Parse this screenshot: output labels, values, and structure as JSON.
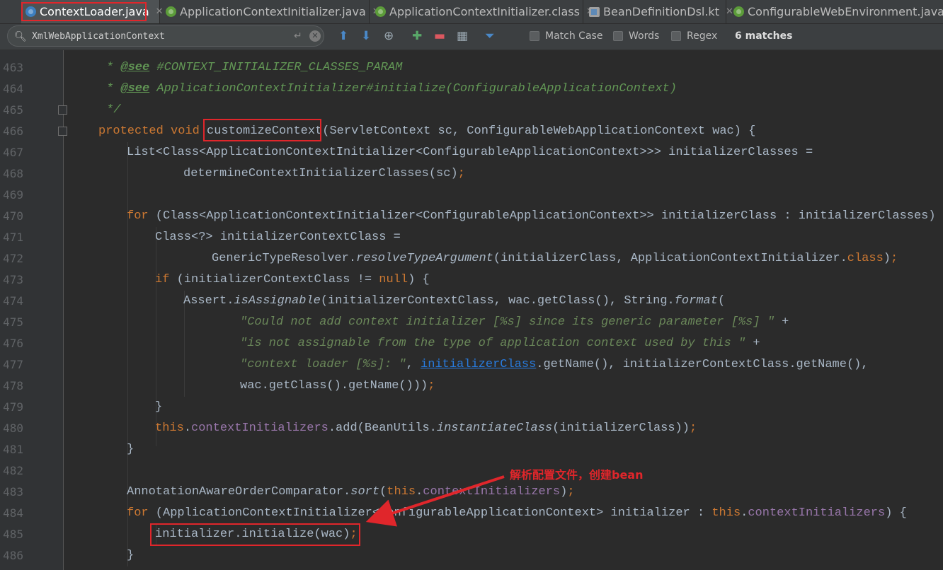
{
  "tabs": [
    {
      "label": "ContextLoader.java",
      "icon": "class-icon",
      "active": true
    },
    {
      "label": "ApplicationContextInitializer.java",
      "icon": "interface-icon"
    },
    {
      "label": "ApplicationContextInitializer.class",
      "icon": "interface-icon"
    },
    {
      "label": "BeanDefinitionDsl.kt",
      "icon": "kotlin-file-icon"
    },
    {
      "label": "ConfigurableWebEnvironment.java",
      "icon": "interface-icon"
    }
  ],
  "find": {
    "query": "XmlWebApplicationContext",
    "match_case": "Match Case",
    "words": "Words",
    "regex": "Regex",
    "matches": "6 matches"
  },
  "code": {
    "line_numbers": [
      "463",
      "464",
      "465",
      "466",
      "467",
      "468",
      "469",
      "470",
      "471",
      "472",
      "473",
      "474",
      "475",
      "476",
      "477",
      "478",
      "479",
      "480",
      "481",
      "482",
      "483",
      "484",
      "485",
      "486"
    ],
    "l463": {
      "star": "* ",
      "tag": "@see",
      "ref": " #CONTEXT_INITIALIZER_CLASSES_PARAM"
    },
    "l464": {
      "star": "* ",
      "tag": "@see",
      "ref": " ApplicationContextInitializer#initialize(ConfigurableApplicationContext)"
    },
    "l465": {
      "end": "*/"
    },
    "l466": {
      "kw": "protected void ",
      "name": "customizeContext",
      "rest": "(ServletContext sc, ConfigurableWebApplicationContext wac) {"
    },
    "l467": {
      "text": "List<Class<ApplicationContextInitializer<ConfigurableApplicationContext>>> initializerClasses ="
    },
    "l468": {
      "text": "determineContextInitializerClasses(sc)",
      "semi": ";"
    },
    "l470": {
      "kw": "for",
      "text": " (Class<ApplicationContextInitializer<ConfigurableApplicationContext>> initializerClass : initializerClasses) {"
    },
    "l471": {
      "text": "Class<?> initializerContextClass ="
    },
    "l472": {
      "a": "GenericTypeResolver.",
      "b": "resolveTypeArgument",
      "c": "(initializerClass, ApplicationContextInitializer.",
      "d": "class",
      "e": ")",
      "semi": ";"
    },
    "l473": {
      "kw": "if",
      "a": " (initializerContextClass != ",
      "null": "null",
      "b": ") {"
    },
    "l474": {
      "a": "Assert.",
      "b": "isAssignable",
      "c": "(initializerContextClass, wac.getClass(), String.",
      "d": "format",
      "e": "("
    },
    "l475": {
      "str": "\"Could not add context initializer [%s] since its generic parameter [%s] \"",
      "plus": " +"
    },
    "l476": {
      "str": "\"is not assignable from the type of application context used by this \"",
      "plus": " +"
    },
    "l477": {
      "str": "\"context loader [%s]: \"",
      "a": ", ",
      "link": "initializerClass",
      "b": ".getName(), initializerContextClass.getName(),"
    },
    "l478": {
      "text": "wac.getClass().getName()))",
      "semi": ";"
    },
    "l479": {
      "text": "}"
    },
    "l480": {
      "this": "this",
      "dot": ".",
      "field": "contextInitializers",
      "a": ".add(BeanUtils.",
      "b": "instantiateClass",
      "c": "(initializerClass))",
      "semi": ";"
    },
    "l481": {
      "text": "}"
    },
    "l483": {
      "a": "AnnotationAwareOrderComparator.",
      "b": "sort",
      "c": "(",
      "this": "this",
      "dot": ".",
      "field": "contextInitializers",
      "d": ")",
      "semi": ";"
    },
    "l484": {
      "kw": "for",
      "a": " (ApplicationContextInitializer<ConfigurableApplicationContext> initializer : ",
      "this": "this",
      "dot": ".",
      "field": "contextInitializers",
      "b": ") {"
    },
    "l485": {
      "text": "initializer.initialize(wac)",
      "semi": ";"
    },
    "l486": {
      "text": "}"
    }
  },
  "annotation": {
    "text": "解析配置文件，创建bean",
    "color": "#e0262b"
  },
  "colors": {
    "keyword": "#cc7832",
    "comment": "#629755",
    "string": "#6a8759",
    "field": "#9876aa",
    "text": "#a9b7c6",
    "background": "#2b2b2b"
  }
}
